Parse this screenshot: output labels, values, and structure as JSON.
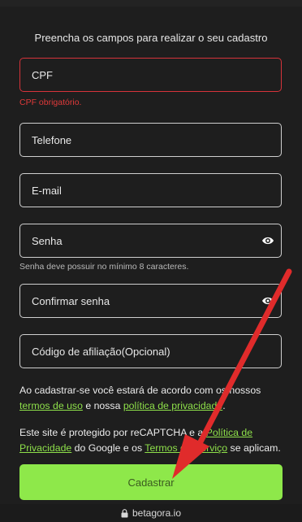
{
  "form": {
    "heading": "Preencha os campos para realizar o seu cadastro",
    "cpf_placeholder": "CPF",
    "cpf_error": "CPF obrigatório.",
    "phone_placeholder": "Telefone",
    "email_placeholder": "E-mail",
    "password_placeholder": "Senha",
    "password_hint": "Senha deve possuir no mínimo 8 caracteres.",
    "confirm_placeholder": "Confirmar senha",
    "affiliate_placeholder": "Código de afiliação(Opcional)"
  },
  "terms": {
    "prefix": "Ao cadastrar-se você estará de acordo com os nossos",
    "terms_link": "termos de uso",
    "middle": " e nossa ",
    "privacy_link": "política de privacidade",
    "suffix": "."
  },
  "recaptcha": {
    "prefix": "Este site é protegido por reCAPTCHA e a ",
    "privacy_link": "Política de Privacidade",
    "middle": " do Google e os ",
    "terms_link": "Termos de Serviço",
    "suffix": " se aplicam."
  },
  "submit_label": "Cadastrar",
  "browser": {
    "url": "betagora.io",
    "lock_icon": "lock-icon"
  },
  "colors": {
    "accent": "#8ee84a",
    "error": "#d6333a",
    "background": "#1e1e1e",
    "annotation_arrow": "#e02b2b"
  }
}
